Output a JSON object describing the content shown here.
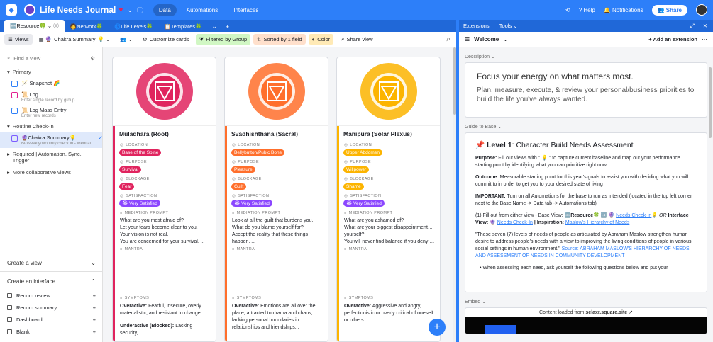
{
  "app": {
    "title": "Life Needs Journal",
    "nav": [
      "Data",
      "Automations",
      "Interfaces"
    ],
    "help": "Help",
    "notifications": "Notifications",
    "share": "Share"
  },
  "tabs": [
    "Resource",
    "Network",
    "Life Levels",
    "Templates"
  ],
  "toolbar": {
    "views": "Views",
    "view_name": "Chakra Summary",
    "customize": "Customize cards",
    "filter": "Filtered by Group",
    "sort": "Sorted by 1 field",
    "color": "Color",
    "share_view": "Share view"
  },
  "sidebar": {
    "find_placeholder": "Find a view",
    "primary": "Primary",
    "items": [
      {
        "name": "Snapshot",
        "sub": ""
      },
      {
        "name": "Log",
        "sub": "Enter single record by group"
      },
      {
        "name": "Log Mass Entry",
        "sub": "Enter new records"
      }
    ],
    "routine": "Routine Check-In",
    "selected": {
      "name": "Chakra Summary",
      "sub": "Bi-Weekly/Monthly check in - Meditat..."
    },
    "required": "Required | Automation, Sync, Trigger",
    "more": "More collaborative views",
    "create_view": "Create a view",
    "create_interface": "Create an interface",
    "interfaces": [
      "Record review",
      "Record summary",
      "Dashboard",
      "Blank"
    ]
  },
  "field_labels": {
    "location": "LOCATION",
    "purpose": "PURPOSE",
    "blockage": "BLOCKAGE",
    "satisfaction": "SATISFACTION",
    "prompt": "MEDIATION PROMPT",
    "mantra": "MANTRA",
    "symptoms": "SYMPTOMS"
  },
  "cards": [
    {
      "title": "Muladhara (Root)",
      "color": "#e0245e",
      "location": "Base of the Spine",
      "purpose": "Survival",
      "blockage": "Fear",
      "satisfaction": "Very Satisfied",
      "prompt": [
        "What are you most afraid of?",
        "Let your fears become clear to you.",
        "Your vision is not real.",
        "You are concerned for your survival. ..."
      ],
      "sym1_label": "Overactive:",
      "sym1": " Fearful, insecure, overly materialistic, and resistant to change",
      "sym2_label": "Underactive (Blocked):",
      "sym2": " Lacking security, ..."
    },
    {
      "title": "Svadhishthana (Sacral)",
      "color": "#ff6f2c",
      "location": "Bellybutton/Pubic Bone",
      "purpose": "Pleasure",
      "blockage": "Guilt",
      "satisfaction": "Very Satisfied",
      "prompt": [
        "Look at all the guilt that burdens you.",
        "What do you blame yourself for?",
        "Accept the reality that these things",
        "happen. ..."
      ],
      "sym1_label": "Overactive:",
      "sym1": " Emotions are all over the place, attracted to drama and chaos, lacking personal boundaries in relationships and friendships...",
      "sym2_label": "",
      "sym2": ""
    },
    {
      "title": "Manipura (Solar Plexus)",
      "color": "#fcb400",
      "location": "Upper Abdomen",
      "purpose": "Willpower",
      "blockage": "Shame",
      "satisfaction": "Very Satisfied",
      "prompt": [
        "What are you ashamed of?",
        "What are your biggest disappointments in",
        "yourself?",
        "You will never find balance if you deny th..."
      ],
      "sym1_label": "Overactive:",
      "sym1": " Aggressive and angry, perfectionistic or overly critical of oneself or others",
      "sym2_label": "",
      "sym2": ""
    }
  ],
  "ext": {
    "title": "Extensions",
    "tools": "Tools",
    "welcome": "Welcome",
    "add": "+ Add an extension",
    "description_label": "Description",
    "desc_big": "Focus your energy on what matters most.",
    "desc_small": "Plan, measure, execute, & review your personal/business priorities to build the life you've always wanted.",
    "guide_label": "Guide to Base",
    "guide_title_bold": "Level 1",
    "guide_title": ": Character Build Needs Assessment",
    "purpose_b": "Purpose:",
    "purpose": " Fill out views with \" 💡 \" to capture current baseline and map out your performance starting point by identifying what you can prioritize right now",
    "outcome_b": "Outcome:",
    "outcome": " Measurable starting point for this year's goals to assist you with deciding what you will commit to in order to get you to your desired state of living",
    "important_b": "IMPORTANT:",
    "important": " Turn on all Automations for the base to run as intended (located in the top left corner next to the Base Name -> Data tab -> Automations tab)",
    "step1_b": "(1) Fill out from either view - Base View:",
    "step1_resource": "Resource",
    "step1_link": "Needs Check-In",
    "step1_or": "OR",
    "step1_iv": "Interface View:",
    "step1_link2": "Needs Check-In",
    "step1_insp": "| Inspiration:",
    "step1_link3": "Maslow's Hierarchy of Needs",
    "quote": "\"These seven (7) levels of needs of people as articulated by Abraham Maslow strengthen human desire to address people's needs with a view to improving the living conditions of people in various social settings in human environment.\"",
    "source": "Source: ABRAHAM MASLOW'S HIERARCHY OF NEEDS AND ASSESSMENT OF NEEDS IN COMMUNITY DEVELOPMENT",
    "bullet": "When assessing each need, ask yourself the following questions below and put your",
    "embed_label": "Embed",
    "embed_text": "Content loaded from",
    "embed_site": "selaxr.square.site"
  }
}
